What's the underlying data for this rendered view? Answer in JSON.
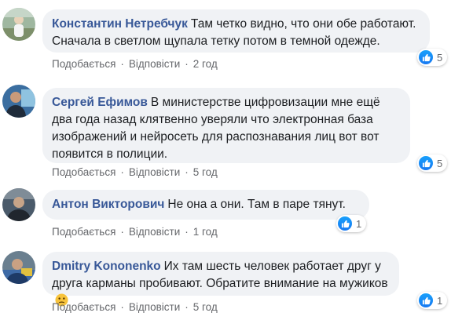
{
  "comments": [
    {
      "author": "Константин Нетребчук",
      "text": "Там четко видно, что они обе работают. Сначала в светлом щупала тетку потом в темной одежде.",
      "like_label": "Подобається",
      "reply_label": "Відповісти",
      "time": "2 год",
      "reactions": "5"
    },
    {
      "author": "Сергей Ефимов",
      "text": "В министерстве цифровизации мне ещё два года назад клятвенно уверяли что электронная база изображений и нейросеть для распознавания лиц вот вот появится в полиции.",
      "like_label": "Подобається",
      "reply_label": "Відповісти",
      "time": "5 год",
      "reactions": "5"
    },
    {
      "author": "Антон Викторович",
      "text": "Не она а они. Там в паре тянут.",
      "like_label": "Подобається",
      "reply_label": "Відповісти",
      "time": "1 год",
      "reactions": "1"
    },
    {
      "author": "Dmitry Kononenko",
      "text": "Их там шесть человек работает друг у друга карманы пробивают. Обратите внимание на мужиков",
      "like_label": "Подобається",
      "reply_label": "Відповісти",
      "time": "5 год",
      "reactions": "1"
    }
  ],
  "colors": {
    "author": "#385898",
    "bubble": "#f0f2f5",
    "like": "#1778f2",
    "meta": "#65676b"
  },
  "icons": {
    "reaction": "like-icon",
    "emoji": "confused-face-icon"
  }
}
